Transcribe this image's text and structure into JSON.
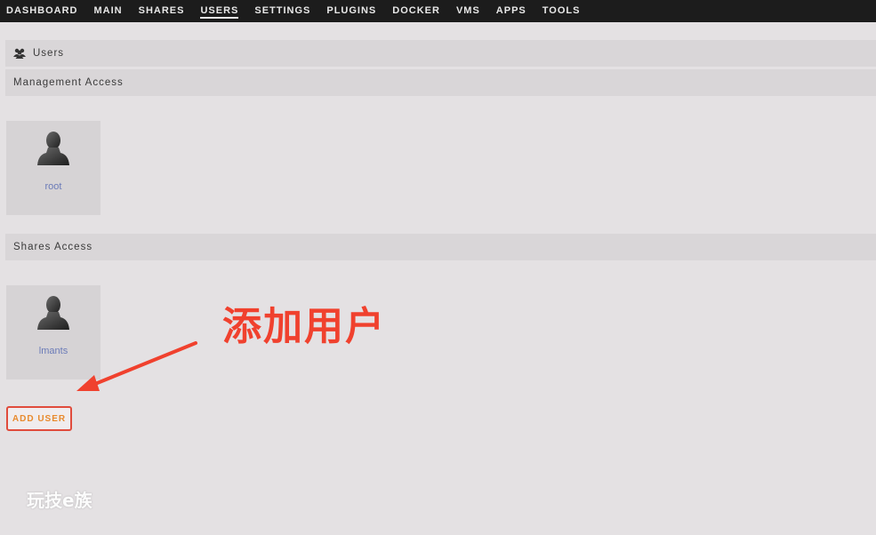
{
  "nav": {
    "items": [
      {
        "label": "DASHBOARD"
      },
      {
        "label": "MAIN"
      },
      {
        "label": "SHARES"
      },
      {
        "label": "USERS"
      },
      {
        "label": "SETTINGS"
      },
      {
        "label": "PLUGINS"
      },
      {
        "label": "DOCKER"
      },
      {
        "label": "VMS"
      },
      {
        "label": "APPS"
      },
      {
        "label": "TOOLS"
      }
    ],
    "active": "USERS"
  },
  "page": {
    "title": "Users",
    "title_icon": "users-icon",
    "management_heading": "Management Access",
    "shares_heading": "Shares Access"
  },
  "management_users": [
    {
      "name": "root",
      "icon": "user-avatar-icon"
    }
  ],
  "shares_users": [
    {
      "name": "lmants",
      "icon": "user-avatar-icon"
    }
  ],
  "actions": {
    "add_user_label": "ADD USER"
  },
  "annotation": {
    "text": "添加用户",
    "color": "#f0412e"
  },
  "watermark": {
    "text": "玩技e族"
  },
  "colors": {
    "nav_bg": "#1c1c1c",
    "page_bg": "#e4e1e3",
    "section_bg": "#d9d6d8",
    "user_name": "#6b7bb8",
    "button_border": "#e04b3c",
    "button_text": "#e88a2e"
  }
}
